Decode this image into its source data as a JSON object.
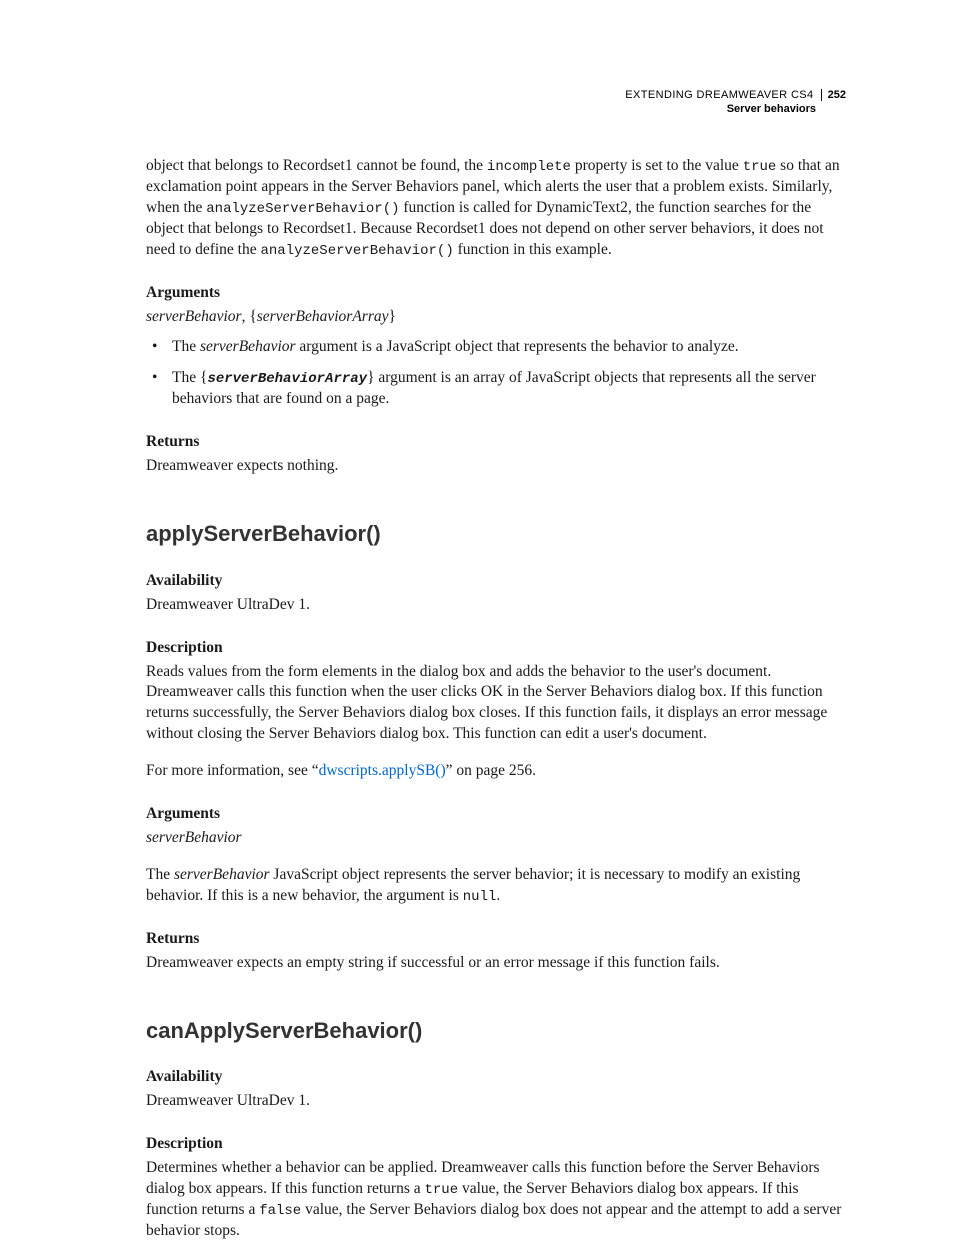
{
  "header": {
    "running_title": "EXTENDING DREAMWEAVER CS4",
    "page_number": "252",
    "section": "Server behaviors"
  },
  "intro": {
    "p1a": "object that belongs to Recordset1 cannot be found, the ",
    "c1": "incomplete",
    "p1b": " property is set to the value ",
    "c2": "true",
    "p1c": " so that an exclamation point appears in the Server Behaviors panel, which alerts the user that a problem exists. Similarly, when the ",
    "c3": "analyzeServerBehavior()",
    "p1d": " function is called for DynamicText2, the function searches for the object that belongs to Recordset1. Because Recordset1 does not depend on other server behaviors, it does not need to define the ",
    "c4": "analyzeServerBehavior()",
    "p1e": " function in this example."
  },
  "arguments1": {
    "label": "Arguments",
    "line_a": "serverBehavior",
    "line_sep": ", {",
    "line_b": "serverBehaviorArray",
    "line_end": "}",
    "b1a": "The ",
    "b1b": "serverBehavior",
    "b1c": " argument is a JavaScript object that represents the behavior to analyze.",
    "b2a": "The ",
    "b2b_pre": "{",
    "b2b": "serverBehaviorArray",
    "b2b_post": "}",
    "b2c": " argument is an array of JavaScript objects that represents all the server behaviors that are found on a page."
  },
  "returns1": {
    "label": "Returns",
    "text": "Dreamweaver expects nothing."
  },
  "apply": {
    "title": "applyServerBehavior()",
    "avail_label": "Availability",
    "avail_text": "Dreamweaver UltraDev 1.",
    "desc_label": "Description",
    "desc_text": "Reads values from the form elements in the dialog box and adds the behavior to the user's document. Dreamweaver calls this function when the user clicks OK in the Server Behaviors dialog box. If this function returns successfully, the Server Behaviors dialog box closes. If this function fails, it displays an error message without closing the Server Behaviors dialog box. This function can edit a user's document.",
    "more_a": "For more information, see “",
    "more_link": "dwscripts.applySB()",
    "more_b": "” on page 256.",
    "args_label": "Arguments",
    "args_line": "serverBehavior",
    "args_p_a": "The ",
    "args_p_b": "serverBehavior",
    "args_p_c": " JavaScript object represents the server behavior; it is necessary to modify an existing behavior. If this is a new behavior, the argument is ",
    "args_p_code": "null",
    "args_p_d": ".",
    "ret_label": "Returns",
    "ret_text": "Dreamweaver expects an empty string if successful or an error message if this function fails."
  },
  "canApply": {
    "title": "canApplyServerBehavior()",
    "avail_label": "Availability",
    "avail_text": "Dreamweaver UltraDev 1.",
    "desc_label": "Description",
    "desc_a": "Determines whether a behavior can be applied. Dreamweaver calls this function before the Server Behaviors dialog box appears. If this function returns a ",
    "desc_c1": "true",
    "desc_b": " value, the Server Behaviors dialog box appears. If this function returns a ",
    "desc_c2": "false",
    "desc_c": " value, the Server Behaviors dialog box does not appear and the attempt to add a server behavior stops."
  }
}
